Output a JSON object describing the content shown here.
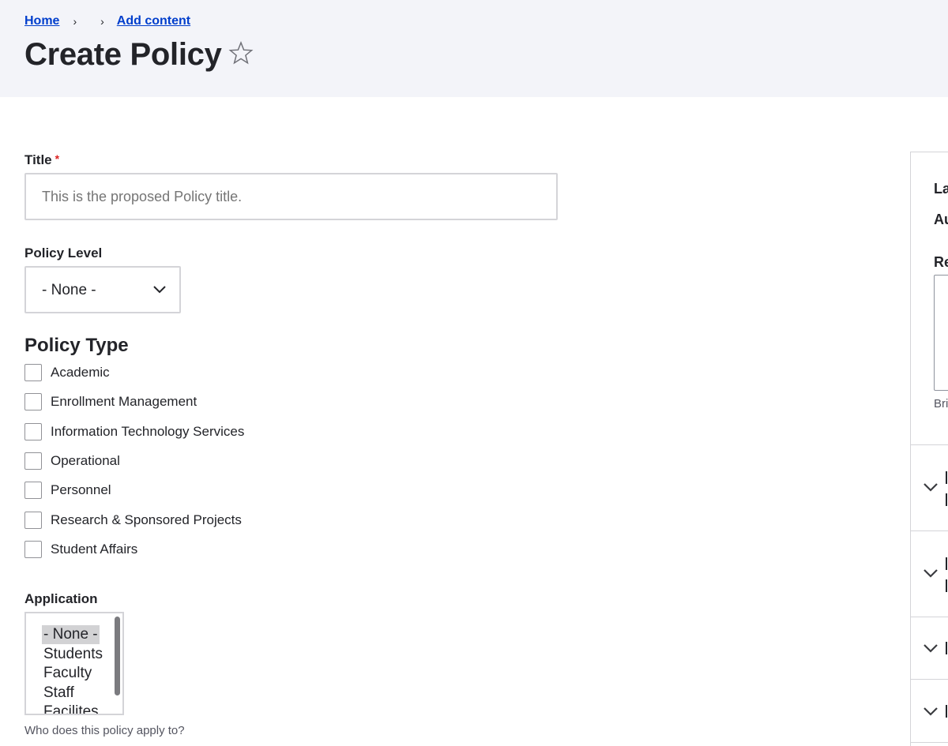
{
  "breadcrumb": {
    "home": "Home",
    "add_content": "Add content"
  },
  "page_title": "Create Policy",
  "form": {
    "title_label": "Title",
    "title_required": "*",
    "title_placeholder": "This is the proposed Policy title.",
    "policy_level_label": "Policy Level",
    "policy_level_value": "- None -",
    "policy_type_heading": "Policy Type",
    "policy_types": [
      {
        "label": "Academic",
        "checked": false
      },
      {
        "label": "Enrollment Management",
        "checked": false
      },
      {
        "label": "Information Technology Services",
        "checked": false
      },
      {
        "label": "Operational",
        "checked": false
      },
      {
        "label": "Personnel",
        "checked": false
      },
      {
        "label": "Research & Sponsored Projects",
        "checked": false
      },
      {
        "label": "Student Affairs",
        "checked": false
      }
    ],
    "application_label": "Application",
    "application_options": [
      "- None -",
      "Students",
      "Faculty",
      "Staff",
      "Facilites"
    ],
    "application_selected": "- None -",
    "application_description": "Who does this policy apply to?"
  },
  "sidebar": {
    "line1": "La",
    "line2": "Au",
    "line3": "Re",
    "help": "Bri"
  },
  "icons": {
    "star": "star-outline-icon",
    "chevron": "chevron-down-icon",
    "breadcrumb_separator": "chevron-right-icon"
  },
  "colors": {
    "link": "#003ecc",
    "required": "#dc2323",
    "header_bg": "#f3f4f9"
  }
}
